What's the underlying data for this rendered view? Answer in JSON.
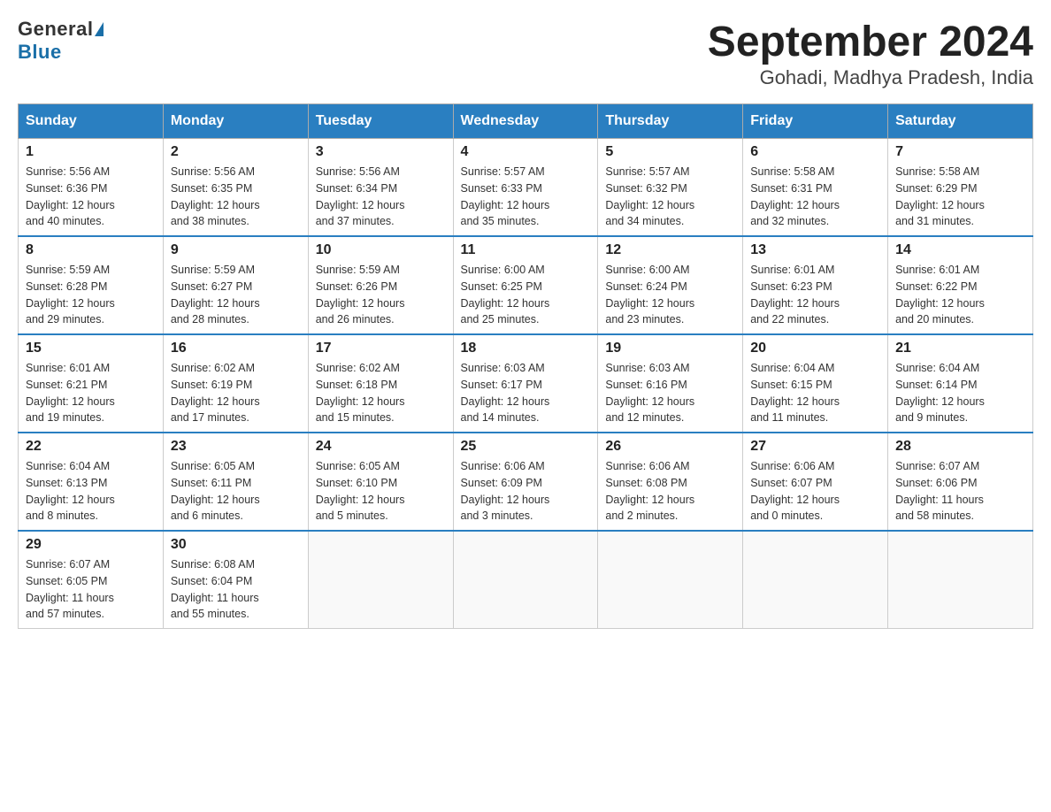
{
  "header": {
    "logo_general": "General",
    "logo_blue": "Blue",
    "title": "September 2024",
    "subtitle": "Gohadi, Madhya Pradesh, India"
  },
  "weekdays": [
    "Sunday",
    "Monday",
    "Tuesday",
    "Wednesday",
    "Thursday",
    "Friday",
    "Saturday"
  ],
  "weeks": [
    [
      {
        "day": "1",
        "sunrise": "5:56 AM",
        "sunset": "6:36 PM",
        "daylight": "12 hours and 40 minutes."
      },
      {
        "day": "2",
        "sunrise": "5:56 AM",
        "sunset": "6:35 PM",
        "daylight": "12 hours and 38 minutes."
      },
      {
        "day": "3",
        "sunrise": "5:56 AM",
        "sunset": "6:34 PM",
        "daylight": "12 hours and 37 minutes."
      },
      {
        "day": "4",
        "sunrise": "5:57 AM",
        "sunset": "6:33 PM",
        "daylight": "12 hours and 35 minutes."
      },
      {
        "day": "5",
        "sunrise": "5:57 AM",
        "sunset": "6:32 PM",
        "daylight": "12 hours and 34 minutes."
      },
      {
        "day": "6",
        "sunrise": "5:58 AM",
        "sunset": "6:31 PM",
        "daylight": "12 hours and 32 minutes."
      },
      {
        "day": "7",
        "sunrise": "5:58 AM",
        "sunset": "6:29 PM",
        "daylight": "12 hours and 31 minutes."
      }
    ],
    [
      {
        "day": "8",
        "sunrise": "5:59 AM",
        "sunset": "6:28 PM",
        "daylight": "12 hours and 29 minutes."
      },
      {
        "day": "9",
        "sunrise": "5:59 AM",
        "sunset": "6:27 PM",
        "daylight": "12 hours and 28 minutes."
      },
      {
        "day": "10",
        "sunrise": "5:59 AM",
        "sunset": "6:26 PM",
        "daylight": "12 hours and 26 minutes."
      },
      {
        "day": "11",
        "sunrise": "6:00 AM",
        "sunset": "6:25 PM",
        "daylight": "12 hours and 25 minutes."
      },
      {
        "day": "12",
        "sunrise": "6:00 AM",
        "sunset": "6:24 PM",
        "daylight": "12 hours and 23 minutes."
      },
      {
        "day": "13",
        "sunrise": "6:01 AM",
        "sunset": "6:23 PM",
        "daylight": "12 hours and 22 minutes."
      },
      {
        "day": "14",
        "sunrise": "6:01 AM",
        "sunset": "6:22 PM",
        "daylight": "12 hours and 20 minutes."
      }
    ],
    [
      {
        "day": "15",
        "sunrise": "6:01 AM",
        "sunset": "6:21 PM",
        "daylight": "12 hours and 19 minutes."
      },
      {
        "day": "16",
        "sunrise": "6:02 AM",
        "sunset": "6:19 PM",
        "daylight": "12 hours and 17 minutes."
      },
      {
        "day": "17",
        "sunrise": "6:02 AM",
        "sunset": "6:18 PM",
        "daylight": "12 hours and 15 minutes."
      },
      {
        "day": "18",
        "sunrise": "6:03 AM",
        "sunset": "6:17 PM",
        "daylight": "12 hours and 14 minutes."
      },
      {
        "day": "19",
        "sunrise": "6:03 AM",
        "sunset": "6:16 PM",
        "daylight": "12 hours and 12 minutes."
      },
      {
        "day": "20",
        "sunrise": "6:04 AM",
        "sunset": "6:15 PM",
        "daylight": "12 hours and 11 minutes."
      },
      {
        "day": "21",
        "sunrise": "6:04 AM",
        "sunset": "6:14 PM",
        "daylight": "12 hours and 9 minutes."
      }
    ],
    [
      {
        "day": "22",
        "sunrise": "6:04 AM",
        "sunset": "6:13 PM",
        "daylight": "12 hours and 8 minutes."
      },
      {
        "day": "23",
        "sunrise": "6:05 AM",
        "sunset": "6:11 PM",
        "daylight": "12 hours and 6 minutes."
      },
      {
        "day": "24",
        "sunrise": "6:05 AM",
        "sunset": "6:10 PM",
        "daylight": "12 hours and 5 minutes."
      },
      {
        "day": "25",
        "sunrise": "6:06 AM",
        "sunset": "6:09 PM",
        "daylight": "12 hours and 3 minutes."
      },
      {
        "day": "26",
        "sunrise": "6:06 AM",
        "sunset": "6:08 PM",
        "daylight": "12 hours and 2 minutes."
      },
      {
        "day": "27",
        "sunrise": "6:06 AM",
        "sunset": "6:07 PM",
        "daylight": "12 hours and 0 minutes."
      },
      {
        "day": "28",
        "sunrise": "6:07 AM",
        "sunset": "6:06 PM",
        "daylight": "11 hours and 58 minutes."
      }
    ],
    [
      {
        "day": "29",
        "sunrise": "6:07 AM",
        "sunset": "6:05 PM",
        "daylight": "11 hours and 57 minutes."
      },
      {
        "day": "30",
        "sunrise": "6:08 AM",
        "sunset": "6:04 PM",
        "daylight": "11 hours and 55 minutes."
      },
      null,
      null,
      null,
      null,
      null
    ]
  ],
  "labels": {
    "sunrise": "Sunrise:",
    "sunset": "Sunset:",
    "daylight": "Daylight:"
  }
}
